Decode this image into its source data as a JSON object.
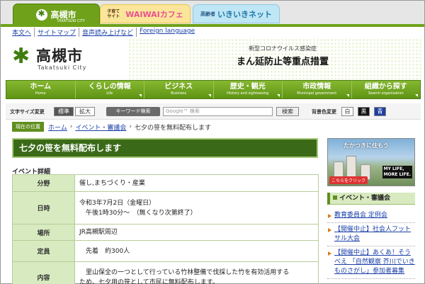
{
  "tabs": {
    "takatsuki": "高槻市",
    "takatsuki_sub": "TAKATSUKI CITY",
    "waiwai_small": "子育て サイト",
    "waiwai": "WAIWAIカフェ",
    "ikiiki_small": "高齢者",
    "ikiiki": "いきいきネット"
  },
  "util_links": [
    "本文へ",
    "サイトマップ",
    "音声読み上げなど",
    "Foreign language"
  ],
  "logo": {
    "name": "高槻市",
    "roman": "Takatsuki City"
  },
  "covid": {
    "sub": "新型コロナウイルス感染症",
    "main": "まん延防止等重点措置"
  },
  "nav": [
    {
      "jp": "ホーム",
      "en": "Home"
    },
    {
      "jp": "くらしの情報",
      "en": "Life"
    },
    {
      "jp": "ビジネス",
      "en": "Business"
    },
    {
      "jp": "歴史・観光",
      "en": "History and sightseeing"
    },
    {
      "jp": "市政情報",
      "en": "Municipal government"
    },
    {
      "jp": "組織から探す",
      "en": "Search organization"
    }
  ],
  "tools": {
    "font_size_label": "文字サイズ変更",
    "standard": "標準",
    "large": "拡大",
    "keyword_label": "キーワード検索",
    "search_placeholder": "Google™ 検索",
    "search_button": "検索",
    "bg_label": "背景色変更",
    "bg_white": "白",
    "bg_black": "黒",
    "bg_blue": "青"
  },
  "breadcrumb": {
    "here": "現在の位置",
    "home": "ホーム",
    "category": "イベント・審議会",
    "current": "七夕の笹を無料配布します"
  },
  "title": "七夕の笹を無料配布します",
  "section_head": "イベント詳細",
  "details": [
    {
      "label": "分野",
      "lines": [
        "催し,まちづくり・産業"
      ]
    },
    {
      "label": "日時",
      "lines": [
        "令和3年7月2日（金曜日）",
        "　午後1時30分～　（無くなり次第終了）"
      ]
    },
    {
      "label": "場所",
      "lines": [
        "JR高槻駅周辺"
      ]
    },
    {
      "label": "定員",
      "lines": [
        "　先着　約300人"
      ]
    },
    {
      "label": "内容",
      "lines": [
        "　里山保全の一つとして行っている竹林整備で伐採した竹を有効活用する",
        "ため、七夕用の笹として市民に無料配布します。"
      ]
    }
  ],
  "side_banner": {
    "title": "たかつきに住もう",
    "life1": "MY LIFE,",
    "life2": "MORE LIFE.",
    "click": "こちらをクリック"
  },
  "side_head": "イベント・審議会",
  "side_items": [
    "教育委員会 定例会",
    "【開催中止】社会人フットサル大会",
    "【開催中止】あくあ！そうべえ 「自然観察 芥川でいきものさがし」参加者募集"
  ],
  "colors": {
    "brand_green": "#6fa21a",
    "title_green": "#3a6a18",
    "link_blue": "#1a3fa8"
  }
}
